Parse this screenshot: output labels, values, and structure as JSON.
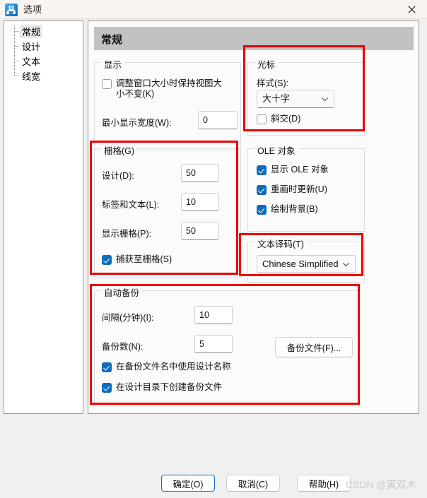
{
  "window": {
    "title": "选项",
    "app_icon": "options-app-icon",
    "close_label": "✕"
  },
  "sidebar": {
    "items": [
      {
        "label": "常规",
        "selected": true
      },
      {
        "label": "设计",
        "selected": false
      },
      {
        "label": "文本",
        "selected": false
      },
      {
        "label": "线宽",
        "selected": false
      }
    ]
  },
  "content": {
    "header": "常规",
    "groups": {
      "display": {
        "legend": "显示",
        "keep_view_size_checkbox": "调整窗口大小时保持视图大小不变(K)",
        "keep_view_size_checked": false,
        "min_width_label": "最小显示宽度(W):",
        "min_width_value": "0"
      },
      "cursor": {
        "legend": "光标",
        "style_label": "样式(S):",
        "style_value": "大十字",
        "oblique_checkbox": "斜交(D)",
        "oblique_checked": false
      },
      "grid": {
        "legend": "栅格(G)",
        "design_label": "设计(D):",
        "design_value": "50",
        "label_text_label": "标签和文本(L):",
        "label_text_value": "10",
        "display_grid_label": "显示栅格(P):",
        "display_grid_value": "50",
        "snap_checkbox": "捕获至栅格(S)",
        "snap_checked": true
      },
      "ole": {
        "legend": "OLE 对象",
        "show_ole_checkbox": "显示 OLE 对象",
        "show_ole_checked": true,
        "update_on_redraw_checkbox": "重画时更新(U)",
        "update_on_redraw_checked": true,
        "draw_background_checkbox": "绘制背景(B)",
        "draw_background_checked": true
      },
      "text_decode": {
        "legend": "文本译码(T)",
        "value": "Chinese Simplified"
      },
      "autobackup": {
        "legend": "自动备份",
        "interval_label": "间隔(分钟)(I):",
        "interval_value": "10",
        "count_label": "备份数(N):",
        "count_value": "5",
        "use_design_name_checkbox": "在备份文件名中使用设计名称",
        "use_design_name_checked": true,
        "create_in_design_dir_checkbox": "在设计目录下创建备份文件",
        "create_in_design_dir_checked": true,
        "backup_files_button": "备份文件(F)..."
      }
    }
  },
  "footer": {
    "ok_label": "确定(O)",
    "cancel_label": "取消(C)",
    "help_label": "帮助(H)"
  },
  "watermark": "CSDN @寅双木",
  "colors": {
    "accent": "#0f6cbd",
    "annotation": "#ee0000",
    "header_bar": "#c2c2c2",
    "titlebar": "#f8f4f1"
  }
}
